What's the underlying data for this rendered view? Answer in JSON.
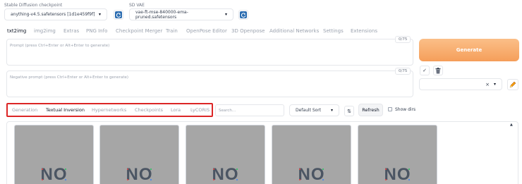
{
  "checkpoint": {
    "label": "Stable Diffusion checkpoint",
    "value": "anything-v4.5.safetensors [1d1e459f9f]"
  },
  "vae": {
    "label": "SD VAE",
    "value": "vae-ft-mse-840000-ema-pruned.safetensors"
  },
  "main_tabs": [
    "txt2img",
    "img2img",
    "Extras",
    "PNG Info",
    "Checkpoint Merger",
    "Train",
    "OpenPose Editor",
    "3D Openpose",
    "Additional Networks",
    "Settings",
    "Extensions"
  ],
  "prompt": {
    "placeholder": "Prompt (press Ctrl+Enter or Alt+Enter to generate)",
    "counter": "0/75"
  },
  "negative_prompt": {
    "placeholder": "Negative prompt (press Ctrl+Enter or Alt+Enter to generate)",
    "counter": "0/75"
  },
  "generate_label": "Generate",
  "style_clear": "×",
  "extra_tabs": [
    "Generation",
    "Textual Inversion",
    "Hypernetworks",
    "Checkpoints",
    "Lora",
    "LyCORIS"
  ],
  "search_placeholder": "Search...",
  "sort_value": "Default Sort",
  "refresh_label": "Refresh",
  "show_dirs_label": "Show dirs",
  "card_placeholder": "NO",
  "colors": {
    "accent_orange": "#f59e5a",
    "highlight_red": "#dc2626",
    "icon_blue": "#2b6cb0"
  }
}
